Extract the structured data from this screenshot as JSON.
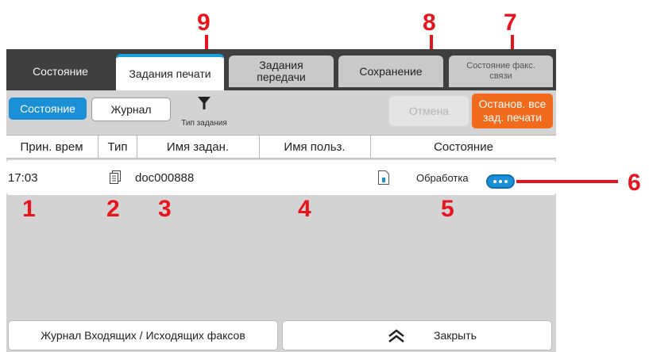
{
  "tabs": [
    {
      "label": "Состояние"
    },
    {
      "label": "Задания печати"
    },
    {
      "label": "Задания передачи"
    },
    {
      "label": "Сохранение"
    },
    {
      "label": "Состояние факс. связи"
    }
  ],
  "toolbar": {
    "status_label": "Состояние",
    "log_label": "Журнал",
    "job_type_label": "Тип задания",
    "cancel_label": "Отмена",
    "stop_all_label": "Останов. все зад. печати"
  },
  "table": {
    "columns": [
      "Прин. врем",
      "Тип",
      "Имя задан.",
      "Имя польз.",
      "Состояние"
    ],
    "rows": [
      {
        "time": "17:03",
        "job_name": "doc000888",
        "user": "",
        "status": "Обработка"
      }
    ]
  },
  "footer": {
    "fax_log_label": "Журнал Входящих / Исходящих факсов",
    "close_label": "Закрыть"
  },
  "callouts": [
    "1",
    "2",
    "3",
    "4",
    "5",
    "6",
    "7",
    "8",
    "9"
  ],
  "colors": {
    "accent_blue": "#1a8fd6",
    "stop_orange": "#f26b1d",
    "callout_red": "#e8141c",
    "tab_dark": "#3f3f3f"
  }
}
